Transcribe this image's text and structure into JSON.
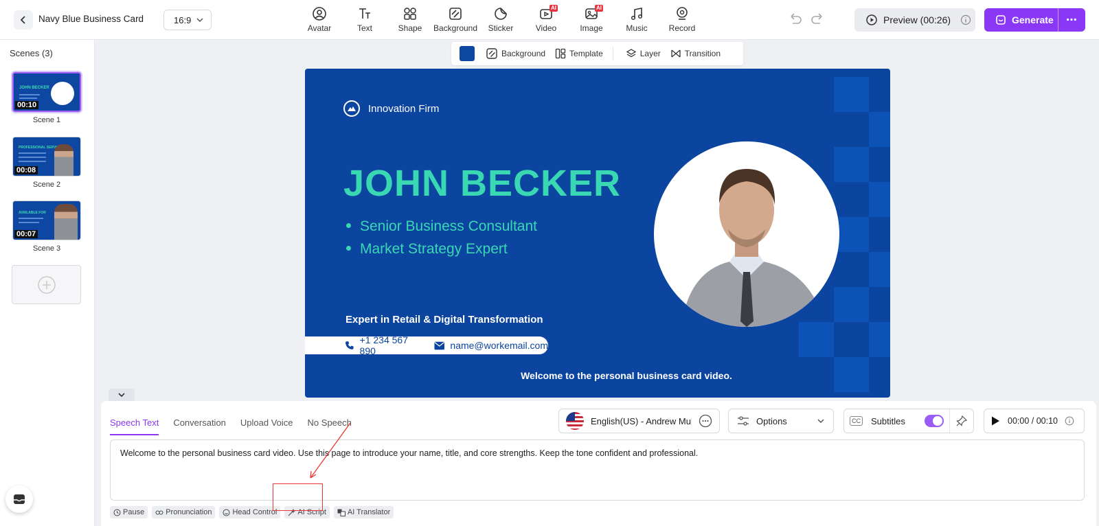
{
  "header": {
    "project_title": "Navy Blue Business Card",
    "aspect_ratio": "16:9",
    "tools": [
      {
        "label": "Avatar",
        "icon": "avatar-icon",
        "ai": false
      },
      {
        "label": "Text",
        "icon": "text-icon",
        "ai": false
      },
      {
        "label": "Shape",
        "icon": "shape-icon",
        "ai": false
      },
      {
        "label": "Background",
        "icon": "background-icon",
        "ai": false
      },
      {
        "label": "Sticker",
        "icon": "sticker-icon",
        "ai": false
      },
      {
        "label": "Video",
        "icon": "video-icon",
        "ai": true
      },
      {
        "label": "Image",
        "icon": "image-icon",
        "ai": true
      },
      {
        "label": "Music",
        "icon": "music-icon",
        "ai": false
      },
      {
        "label": "Record",
        "icon": "record-icon",
        "ai": false
      }
    ],
    "ai_badge": "AI",
    "preview_label": "Preview (00:26)",
    "generate_label": "Generate",
    "more_label": "⋯"
  },
  "sidebar": {
    "title": "Scenes (3)",
    "scenes": [
      {
        "label": "Scene 1",
        "duration": "00:10",
        "active": true
      },
      {
        "label": "Scene 2",
        "duration": "00:08",
        "active": false
      },
      {
        "label": "Scene 3",
        "duration": "00:07",
        "active": false
      }
    ]
  },
  "canvas_toolbar": {
    "color": "#0d47a1",
    "background_label": "Background",
    "template_label": "Template",
    "layer_label": "Layer",
    "transition_label": "Transition"
  },
  "slide": {
    "firm": "Innovation Firm",
    "name": "JOHN BECKER",
    "roles": [
      "Senior Business Consultant",
      "Market Strategy Expert"
    ],
    "expertise": "Expert in Retail & Digital Transformation",
    "phone": "+1 234 567 890",
    "email": "name@workemail.com",
    "caption": "Welcome to the personal business card video.",
    "colors": {
      "background": "#0b45a0",
      "accent": "#39d8b3"
    }
  },
  "panel": {
    "tabs": [
      "Speech Text",
      "Conversation",
      "Upload Voice",
      "No Speech"
    ],
    "active_tab": "Speech Text",
    "voice": "English(US) - Andrew Multil...",
    "options_label": "Options",
    "subtitles_label": "Subtitles",
    "subtitles_on": true,
    "time": "00:00 / 00:10",
    "script_text": "Welcome to the personal business card video. Use this page to introduce your name, title, and core strengths. Keep the tone confident and professional.",
    "script_tools": [
      "Pause",
      "Pronunciation",
      "Head Control",
      "AI Script",
      "AI Translator"
    ],
    "highlighted_tool": "AI Script"
  }
}
